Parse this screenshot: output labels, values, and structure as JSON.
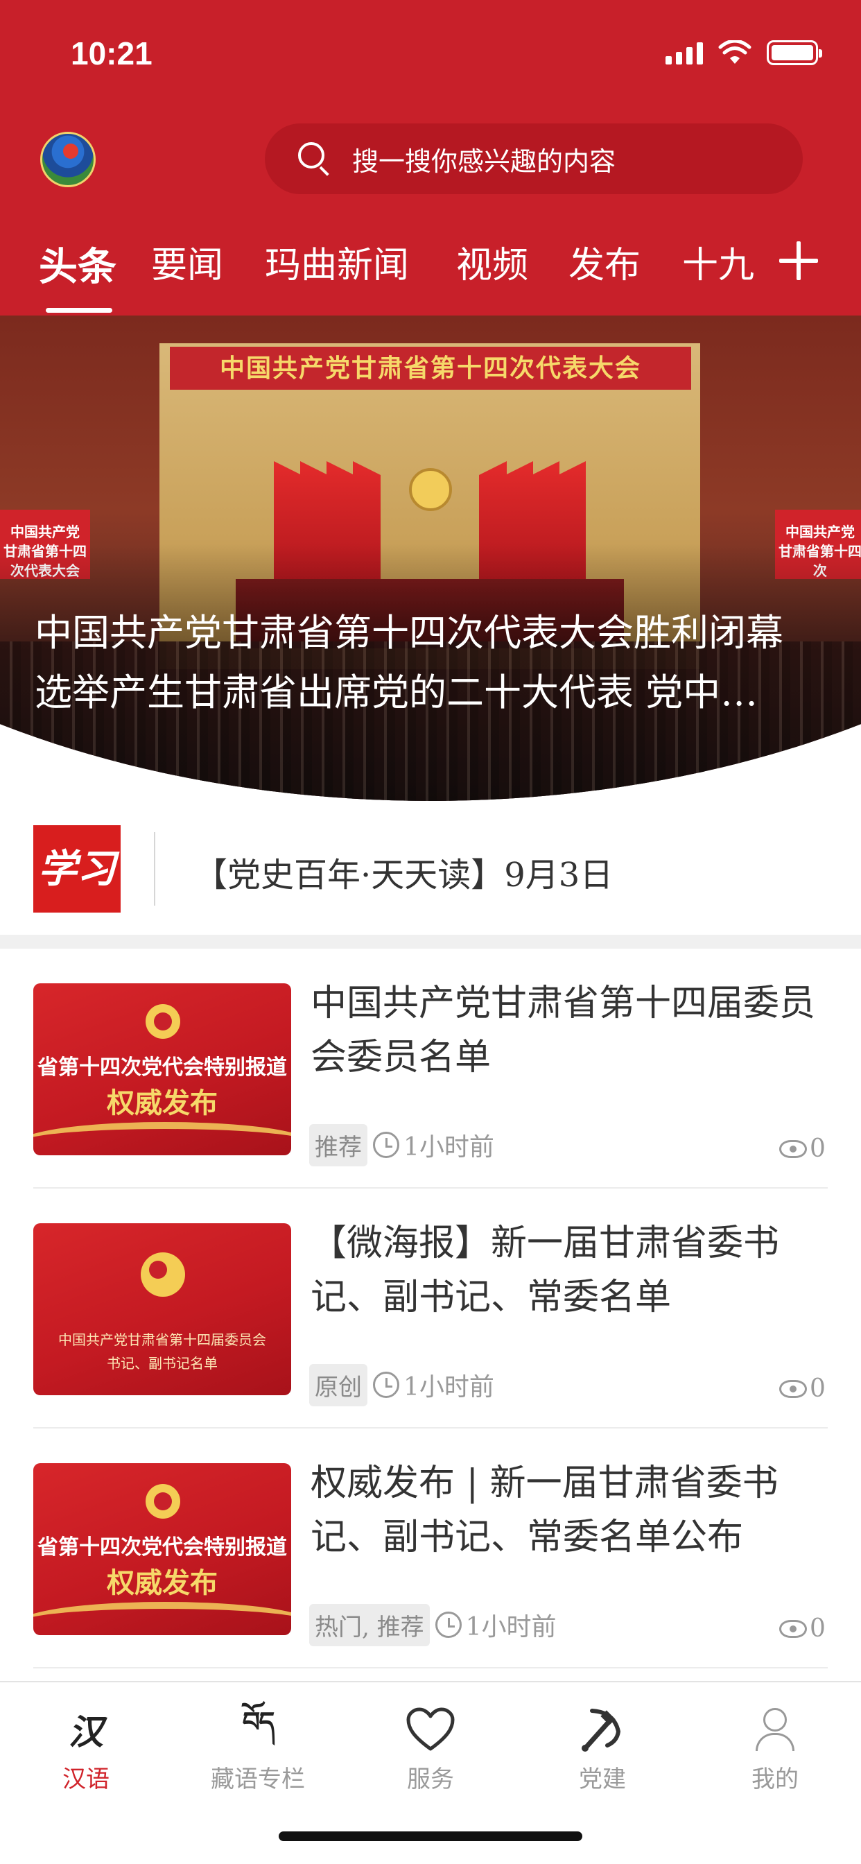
{
  "status_bar": {
    "time": "10:21"
  },
  "header": {
    "search_placeholder": "搜一搜你感兴趣的内容",
    "tabs": [
      {
        "label": "头条"
      },
      {
        "label": "要闻"
      },
      {
        "label": "玛曲新闻"
      },
      {
        "label": "视频"
      },
      {
        "label": "发布"
      },
      {
        "label": "十九"
      }
    ]
  },
  "hero": {
    "banner_text": "中国共产党甘肃省第十四次代表大会",
    "side_sign_left": "中国共产党\n甘肃省第十四次代表大会",
    "side_sign_right": "中国共产党\n甘肃省第十四次",
    "title_line1": "中国共产党甘肃省第十四次代表大会胜利闭幕",
    "title_line2": "选举产生甘肃省出席党的二十大代表 党中…"
  },
  "study": {
    "logo_text": "学习",
    "text": "【党史百年·天天读】9月3日"
  },
  "news": [
    {
      "title": "中国共产党甘肃省第十四届委员会委员名单",
      "thumb_line1": "省第十四次党代会特别报道",
      "thumb_line2": "权威发布",
      "tag": "推荐",
      "time": "1小时前",
      "views": "0"
    },
    {
      "title": "【微海报】新一届甘肃省委书记、副书记、常委名单",
      "thumb_line1": "中国共产党甘肃省第十四届委员会",
      "thumb_line2": "书记、副书记名单",
      "tag": "原创",
      "time": "1小时前",
      "views": "0"
    },
    {
      "title": "权威发布 | 新一届甘肃省委书记、副书记、常委名单公布",
      "thumb_line1": "省第十四次党代会特别报道",
      "thumb_line2": "权威发布",
      "tag": "热门, 推荐",
      "time": "1小时前",
      "views": "0"
    }
  ],
  "bottom_nav": [
    {
      "label": "汉语",
      "icon": "han-glyph-icon",
      "glyph": "汉"
    },
    {
      "label": "藏语专栏",
      "icon": "tibetan-glyph-icon",
      "glyph": "བོད"
    },
    {
      "label": "服务",
      "icon": "heart-icon"
    },
    {
      "label": "党建",
      "icon": "party-emblem-icon"
    },
    {
      "label": "我的",
      "icon": "user-icon"
    }
  ],
  "colors": {
    "brand_red": "#c8202a",
    "active_nav": "#d0232a",
    "muted": "#999999"
  }
}
